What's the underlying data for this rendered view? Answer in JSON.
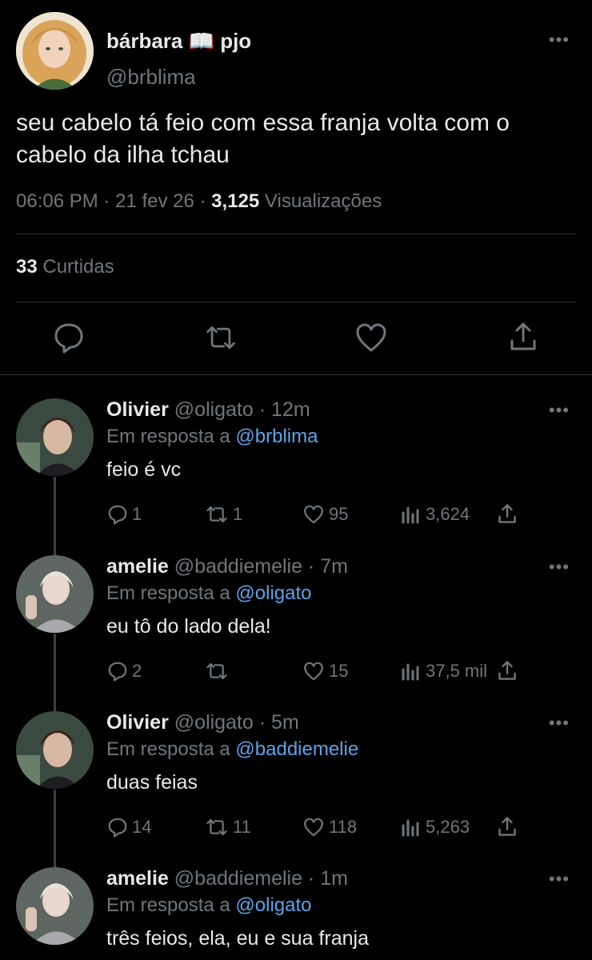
{
  "tweet": {
    "display_name": "bárbara 📖 pjo",
    "handle": "@brblima",
    "text": "seu cabelo tá feio com essa franja volta com o cabelo da ilha tchau",
    "time": "06:06 PM",
    "date": "21 fev 26",
    "views_count": "3,125",
    "views_label": "Visualizações",
    "likes_count": "33",
    "likes_label": "Curtidas",
    "actions": [
      "reply-icon",
      "retweet-icon",
      "like-icon",
      "share-icon"
    ]
  },
  "reply_prefix": "Em resposta a",
  "replies": [
    {
      "name": "Olivier",
      "meta": "@oligato · 12m",
      "reply_to": "@brblima",
      "text": "feio é vc",
      "replies": "1",
      "retweets": "1",
      "likes": "95",
      "views": "3,624"
    },
    {
      "name": "amelie",
      "meta": "@baddiemelie · 7m",
      "reply_to": "@oligato",
      "text": "eu tô do lado dela!",
      "replies": "2",
      "retweets": "",
      "likes": "15",
      "views": "37,5 mil"
    },
    {
      "name": "Olivier",
      "meta": "@oligato · 5m",
      "reply_to": "@baddiemelie",
      "text": "duas feias",
      "replies": "14",
      "retweets": "11",
      "likes": "118",
      "views": "5,263"
    },
    {
      "name": "amelie",
      "meta": "@baddiemelie · 1m",
      "reply_to": "@oligato",
      "text": "três feios, ela, eu e sua franja"
    }
  ],
  "colors": {
    "background": "#000000",
    "text": "#e7e9ea",
    "muted": "#71767b",
    "mention": "#5ea3e6",
    "divider": "#2f3336"
  }
}
